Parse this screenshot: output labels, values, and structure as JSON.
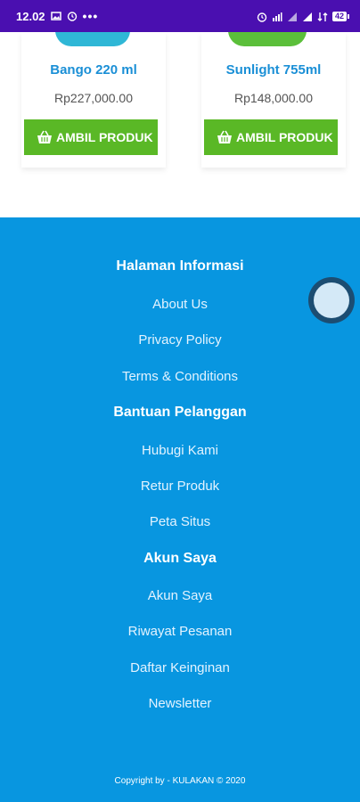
{
  "status_bar": {
    "time": "12.02",
    "more": "•••",
    "battery": "42"
  },
  "products": [
    {
      "name": "Bango 220 ml",
      "price": "Rp227,000.00",
      "button": "AMBIL PRODUK"
    },
    {
      "name": "Sunlight 755ml",
      "price": "Rp148,000.00",
      "button": "AMBIL PRODUK"
    }
  ],
  "footer": {
    "sections": [
      {
        "title": "Halaman Informasi",
        "links": [
          "About Us",
          "Privacy Policy",
          "Terms & Conditions"
        ]
      },
      {
        "title": "Bantuan Pelanggan",
        "links": [
          "Hubugi Kami",
          "Retur Produk",
          "Peta Situs"
        ]
      },
      {
        "title": "Akun Saya",
        "links": [
          "Akun Saya",
          "Riwayat Pesanan",
          "Daftar Keinginan",
          "Newsletter"
        ]
      }
    ],
    "copyright": "Copyright by - KULAKAN © 2020"
  },
  "colors": {
    "status_bar": "#4a0fb0",
    "footer": "#0896e0",
    "button": "#5ab826",
    "product_name": "#1a8fd6"
  }
}
